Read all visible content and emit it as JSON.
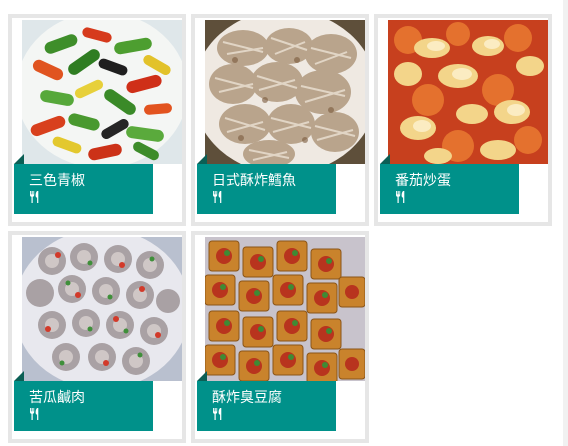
{
  "colors": {
    "label_bg": "#00918a",
    "label_fold": "#0b5f55",
    "card_border": "#e6e6e6",
    "text": "#ffffff"
  },
  "dishes": [
    {
      "name": "三色青椒",
      "icon": "cutlery-icon"
    },
    {
      "name": "日式酥炸鱈魚",
      "icon": "cutlery-icon"
    },
    {
      "name": "番茄炒蛋",
      "icon": "cutlery-icon"
    },
    {
      "name": "苦瓜鹹肉",
      "icon": "cutlery-icon"
    },
    {
      "name": "酥炸臭豆腐",
      "icon": "cutlery-icon"
    }
  ]
}
